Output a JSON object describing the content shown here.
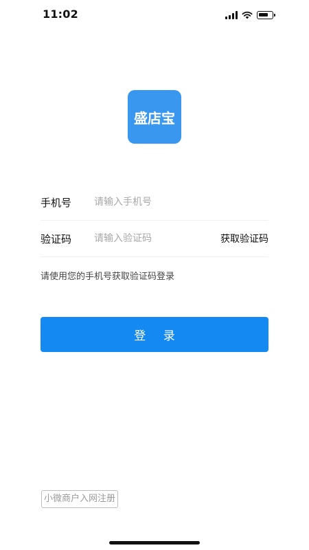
{
  "status_bar": {
    "time": "11:02"
  },
  "app": {
    "logo_text": "盛店宝"
  },
  "form": {
    "phone": {
      "label": "手机号",
      "placeholder": "请输入手机号"
    },
    "code": {
      "label": "验证码",
      "placeholder": "请输入验证码",
      "get_code_label": "获取验证码"
    },
    "hint": "请使用您的手机号获取验证码登录",
    "login_label": "登 录"
  },
  "footer": {
    "register_link": "小微商户入网注册"
  },
  "colors": {
    "primary": "#1389f1",
    "logo_bg": "#3a97ef"
  },
  "icons": [
    "cellular-signal-icon",
    "wifi-icon",
    "battery-icon"
  ]
}
